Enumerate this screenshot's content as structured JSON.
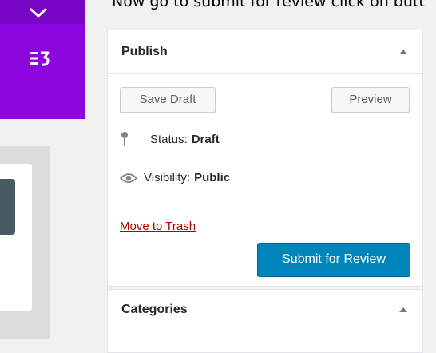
{
  "caption": {
    "text": "Now go to submit for review click on butt"
  },
  "left_panel": {
    "chevron_icon": "chevron-down-icon",
    "elementor_icon": "elementor-icon",
    "colors": {
      "purple": "#8c07dd",
      "purple_dark": "#7a06c5"
    }
  },
  "publish": {
    "title": "Publish",
    "save_draft_label": "Save Draft",
    "preview_label": "Preview",
    "status": {
      "icon": "pin-icon",
      "label": "Status:",
      "value": "Draft"
    },
    "visibility": {
      "icon": "eye-icon",
      "label": "Visibility:",
      "value": "Public"
    },
    "trash_label": "Move to Trash",
    "submit_label": "Submit for Review",
    "colors": {
      "primary": "#0085ba",
      "trash": "#aa0000"
    }
  },
  "categories": {
    "title": "Categories"
  }
}
